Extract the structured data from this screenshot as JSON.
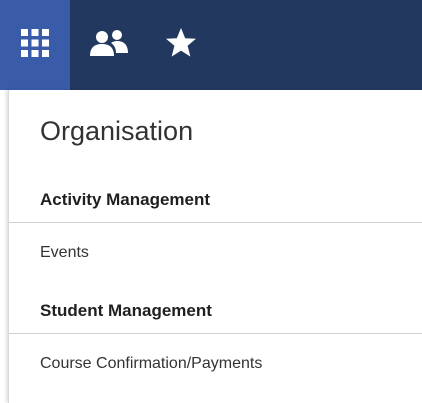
{
  "nav": {
    "tabs": [
      {
        "icon": "apps-grid-icon",
        "active": true
      },
      {
        "icon": "people-icon",
        "active": false
      },
      {
        "icon": "star-icon",
        "active": false
      }
    ]
  },
  "menu": {
    "title": "Organisation",
    "sections": [
      {
        "heading": "Activity Management",
        "items": [
          {
            "label": "Events"
          }
        ]
      },
      {
        "heading": "Student Management",
        "items": [
          {
            "label": "Course Confirmation/Payments"
          }
        ]
      }
    ]
  },
  "colors": {
    "topbar": "#22385f",
    "active_tab": "#3a5ca8",
    "icon": "#ffffff"
  }
}
